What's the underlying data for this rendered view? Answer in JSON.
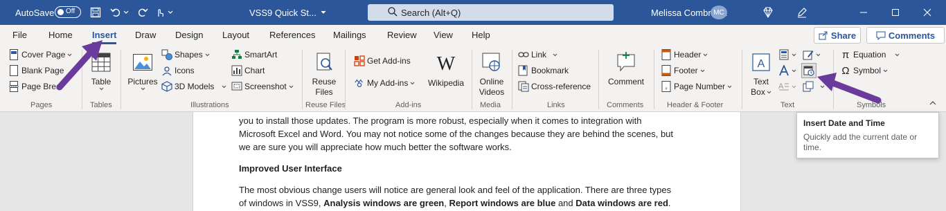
{
  "titlebar": {
    "autosave_label": "AutoSave",
    "autosave_state": "Off",
    "document_title": "VSS9 Quick St...",
    "search_placeholder": "Search (Alt+Q)",
    "user_name": "Melissa Combrinck",
    "user_initials": "MC",
    "accent_color": "#2b579a"
  },
  "tabs": {
    "file": "File",
    "home": "Home",
    "insert": "Insert",
    "draw": "Draw",
    "design": "Design",
    "layout": "Layout",
    "references": "References",
    "mailings": "Mailings",
    "review": "Review",
    "view": "View",
    "help": "Help",
    "share": "Share",
    "comments": "Comments"
  },
  "ribbon": {
    "pages": {
      "cover_page": "Cover Page",
      "blank_page": "Blank Page",
      "page_break": "Page Brea",
      "group_label": "Pages"
    },
    "tables": {
      "table": "Table",
      "group_label": "Tables"
    },
    "illustrations": {
      "pictures": "Pictures",
      "shapes": "Shapes",
      "icons": "Icons",
      "models_3d": "3D Models",
      "smartart": "SmartArt",
      "chart": "Chart",
      "screenshot": "Screenshot",
      "group_label": "Illustrations"
    },
    "reuse_files": {
      "line1": "Reuse",
      "line2": "Files",
      "group_label": "Reuse Files"
    },
    "addins": {
      "get_addins": "Get Add-ins",
      "my_addins": "My Add-ins",
      "wikipedia": "Wikipedia",
      "group_label": "Add-ins"
    },
    "media": {
      "line1": "Online",
      "line2": "Videos",
      "group_label": "Media"
    },
    "links": {
      "link": "Link",
      "bookmark": "Bookmark",
      "cross_reference": "Cross-reference",
      "group_label": "Links"
    },
    "comments": {
      "comment": "Comment",
      "group_label": "Comments"
    },
    "header_footer": {
      "header": "Header",
      "footer": "Footer",
      "page_number": "Page Number",
      "group_label": "Header & Footer"
    },
    "text": {
      "textbox_line1": "Text",
      "textbox_line2": "Box",
      "group_label": "Text"
    },
    "symbols": {
      "equation": "Equation",
      "symbol": "Symbol",
      "group_label": "Symbols"
    }
  },
  "document": {
    "line1": "you to install those updates.  The program is more robust, especially when it comes to integration with",
    "line2": "Microsoft Excel and Word.  You may not notice some of the changes because they are behind the scenes, but",
    "line3": "we are sure you will appreciate how much better the software works.",
    "heading": "Improved User Interface",
    "line4": "The most obvious change users will notice are general look and feel of the application. There are three types",
    "line5_a": "of windows in VSS9, ",
    "line5_b": "Analysis windows are green",
    "line5_c": ", ",
    "line5_d": "Report windows are blue",
    "line5_e": " and ",
    "line5_f": "Data windows are red",
    "line5_g": "."
  },
  "tooltip": {
    "title": "Insert Date and Time",
    "description": "Quickly add the current date or time."
  },
  "annotation_color": "#6a3a9c"
}
